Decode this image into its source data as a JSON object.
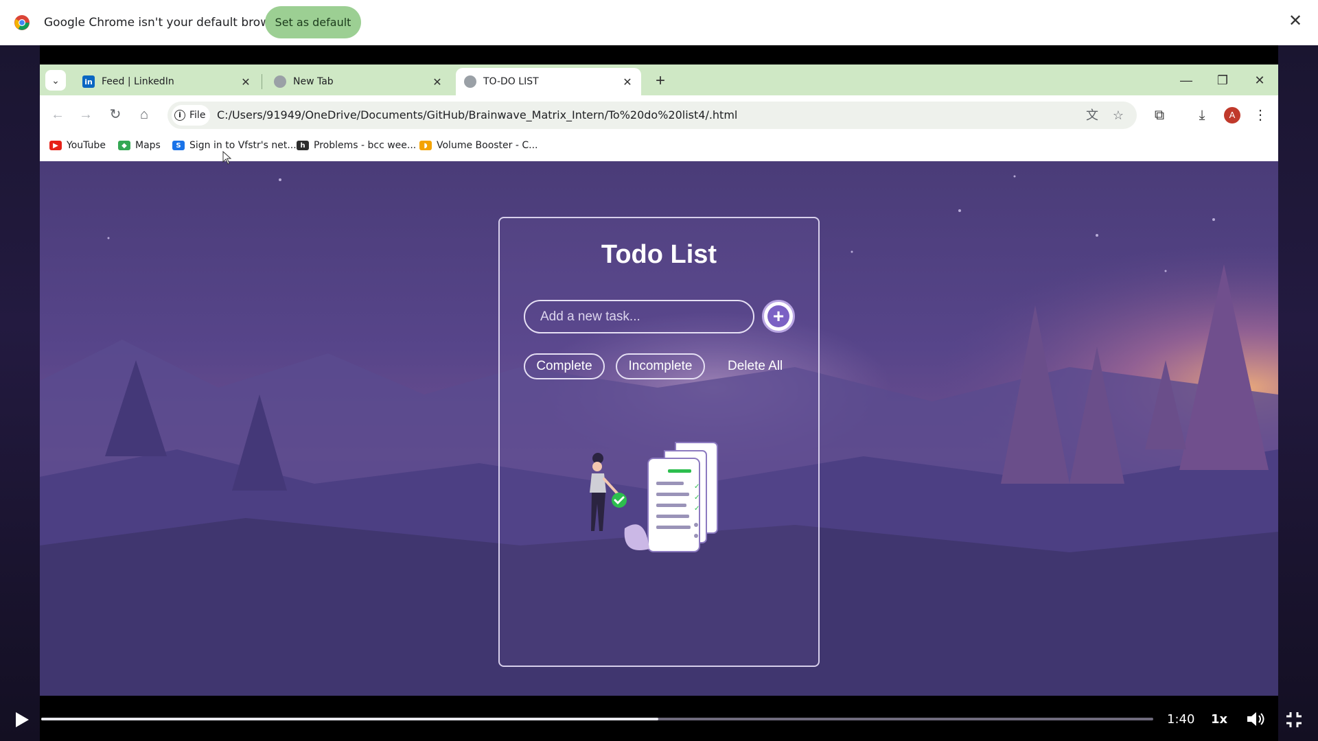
{
  "notification_bar": {
    "message": "Google Chrome isn't your default browser",
    "set_default_label": "Set as default",
    "close_icon": "close-icon"
  },
  "browser": {
    "tabs": [
      {
        "title": "Feed | LinkedIn",
        "icon": "linkedin-icon",
        "active": false
      },
      {
        "title": "New Tab",
        "icon": "globe-icon",
        "active": false
      },
      {
        "title": "TO-DO LIST",
        "icon": "globe-icon",
        "active": true
      }
    ],
    "address_bar": {
      "scheme_chip": "File",
      "url": "C:/Users/91949/OneDrive/Documents/GitHub/Brainwave_Matrix_Intern/To%20do%20list4/.html"
    },
    "profile_initial": "A",
    "bookmarks": [
      {
        "label": "YouTube",
        "icon": "youtube-icon",
        "color": "#e62117"
      },
      {
        "label": "Maps",
        "icon": "maps-icon",
        "color": "#34a853"
      },
      {
        "label": "Sign in to Vfstr's net...",
        "icon": "s-icon",
        "color": "#1a73e8"
      },
      {
        "label": "Problems - bcc wee...",
        "icon": "h-icon",
        "color": "#2d2d2d"
      },
      {
        "label": "Volume Booster - C...",
        "icon": "volume-booster-icon",
        "color": "#f4a300"
      }
    ]
  },
  "todo_app": {
    "title": "Todo List",
    "input_placeholder": "Add a new task...",
    "filters": {
      "complete": "Complete",
      "incomplete": "Incomplete",
      "delete_all": "Delete All"
    },
    "accent_color": "#7b61c4"
  },
  "video_player": {
    "time": "1:40",
    "speed": "1x",
    "progress": 0.555
  }
}
